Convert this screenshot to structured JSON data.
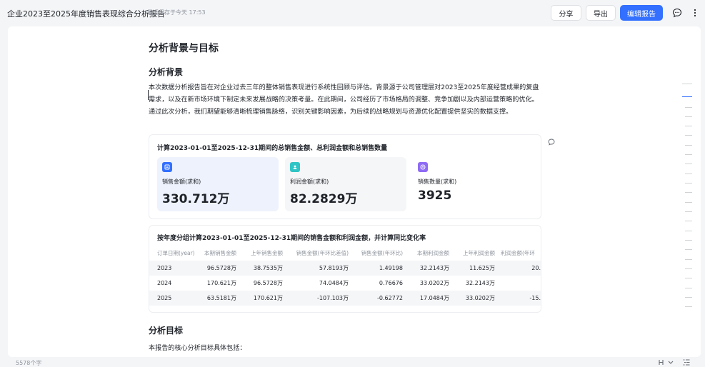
{
  "header": {
    "title": "企业2023至2025年度销售表现综合分析报告",
    "save_status": "最近保存于今天 17:53",
    "share_label": "分享",
    "export_label": "导出",
    "edit_label": "编辑报告"
  },
  "doc": {
    "h1": "分析背景与目标",
    "section1_title": "分析背景",
    "section1_text": "本次数据分析报告旨在对企业过去三年的整体销售表现进行系统性回顾与评估。背景源于公司管理层对2023至2025年度经营成果的复盘需求，以及在新市场环境下制定未来发展战略的决策考量。在此期间，公司经历了市场格局的调整、竞争加剧以及内部运营策略的优化。通过此次分析，我们期望能够清晰梳理销售脉络，识别关键影响因素，为后续的战略规划与资源优化配置提供坚实的数据支撑。",
    "section2_title": "分析目标",
    "section2_text": "本报告的核心分析目标具体包括："
  },
  "summary_card": {
    "title": "计算2023-01-01至2025-12-31期间的总销售金额、总利润金额和总销售数量",
    "metrics": [
      {
        "label": "销售金额(求和)",
        "value": "330.712万",
        "icon": "sales-icon",
        "color": "#3370ff"
      },
      {
        "label": "利润金额(求和)",
        "value": "82.2829万",
        "icon": "profit-icon",
        "color": "#2fc4c5"
      },
      {
        "label": "销售数量(求和)",
        "value": "3925",
        "icon": "quantity-icon",
        "color": "#8f6bf5"
      }
    ]
  },
  "yearly_table": {
    "title": "按年度分组计算2023-01-01至2025-12-31期间的销售金额和利润金额，并计算同比变化率",
    "columns": [
      "订单日期(year)",
      "本期销售金额",
      "上年销售金额",
      "销售金额(年环比差值)",
      "销售金额(年环比)",
      "本期利润金额",
      "上年利润金额",
      "利润金额(年环"
    ],
    "rows": [
      [
        "2023",
        "96.5728万",
        "38.7535万",
        "57.8193万",
        "1.49198",
        "32.2143万",
        "11.625万",
        "20."
      ],
      [
        "2024",
        "170.621万",
        "96.5728万",
        "74.0484万",
        "0.76676",
        "33.0202万",
        "32.2143万",
        ""
      ],
      [
        "2025",
        "63.5181万",
        "170.621万",
        "-107.103万",
        "-0.62772",
        "17.0484万",
        "33.0202万",
        "-15."
      ]
    ]
  },
  "footer": {
    "word_count": "5578个字"
  }
}
